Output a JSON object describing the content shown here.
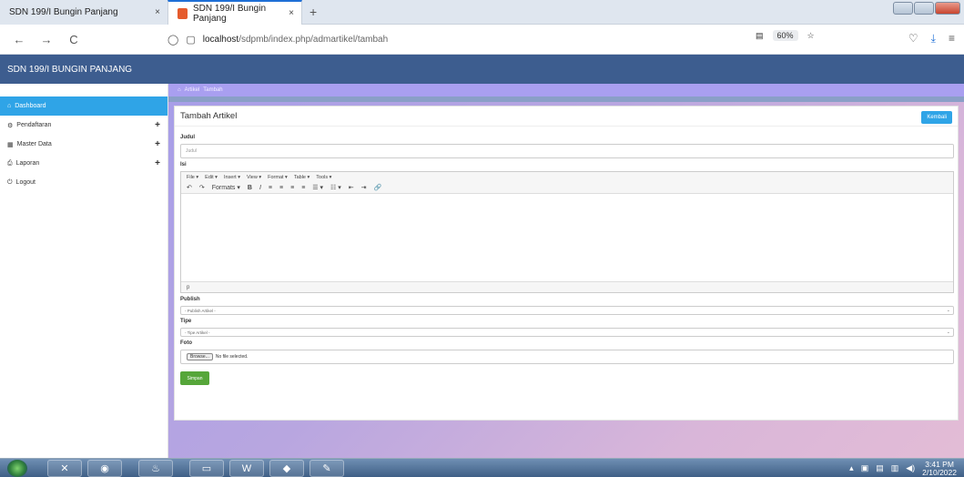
{
  "browser": {
    "tabs": [
      {
        "title": "SDN 199/I Bungin Panjang",
        "close": "×"
      },
      {
        "title": "SDN 199/I Bungin Panjang",
        "close": "×"
      }
    ],
    "new_tab": "+",
    "url_host": "localhost",
    "url_path": "/sdpmb/index.php/admartikel/tambah",
    "zoom": "60%",
    "icons": {
      "back": "←",
      "forward": "→",
      "reload": "C",
      "shield": "◯",
      "page": "▢",
      "reader": "▤",
      "star": "☆",
      "pocket": "♡",
      "download": "⤓",
      "menu": "≡"
    }
  },
  "app": {
    "brand": "SDN 199/I BUNGIN PANJANG",
    "sidebar": [
      {
        "label": "Dashboard",
        "icon": "⌂",
        "active": true,
        "plus": ""
      },
      {
        "label": "Pendaftaran",
        "icon": "⚙",
        "active": false,
        "plus": "+"
      },
      {
        "label": "Master Data",
        "icon": "▦",
        "active": false,
        "plus": "+"
      },
      {
        "label": "Laporan",
        "icon": "⎙",
        "active": false,
        "plus": "+"
      },
      {
        "label": "Logout",
        "icon": "⏻",
        "active": false,
        "plus": ""
      }
    ],
    "breadcrumb": {
      "home_icon": "⌂",
      "section": "Artikel",
      "page": "Tambah"
    },
    "panel_title": "Tambah Artikel",
    "back_button": "Kembali",
    "form": {
      "judul_label": "Judul",
      "judul_placeholder": "Judul",
      "isi_label": "Isi",
      "editor_menu": [
        "File ▾",
        "Edit ▾",
        "Insert ▾",
        "View ▾",
        "Format ▾",
        "Table ▾",
        "Tools ▾"
      ],
      "editor_tools": [
        "↶",
        "↷",
        "Formats ▾",
        "B",
        "I",
        "≡",
        "≡",
        "≡",
        "≡",
        "☰ ▾",
        "☷ ▾",
        "⇤",
        "⇥",
        "🔗"
      ],
      "editor_status": "p",
      "publish_label": "Publish",
      "publish_value": "- Publish Artikel -",
      "tipe_label": "Tipe",
      "tipe_value": "- Tipe Artikel -",
      "foto_label": "Foto",
      "browse_label": "Browse...",
      "file_status": "No file selected.",
      "submit_label": "Simpan"
    }
  },
  "taskbar": {
    "apps": [
      "vscode",
      "firefox",
      "xampp",
      "explorer",
      "word",
      "git",
      "paint"
    ],
    "time": "3:41 PM",
    "date": "2/10/2022"
  }
}
